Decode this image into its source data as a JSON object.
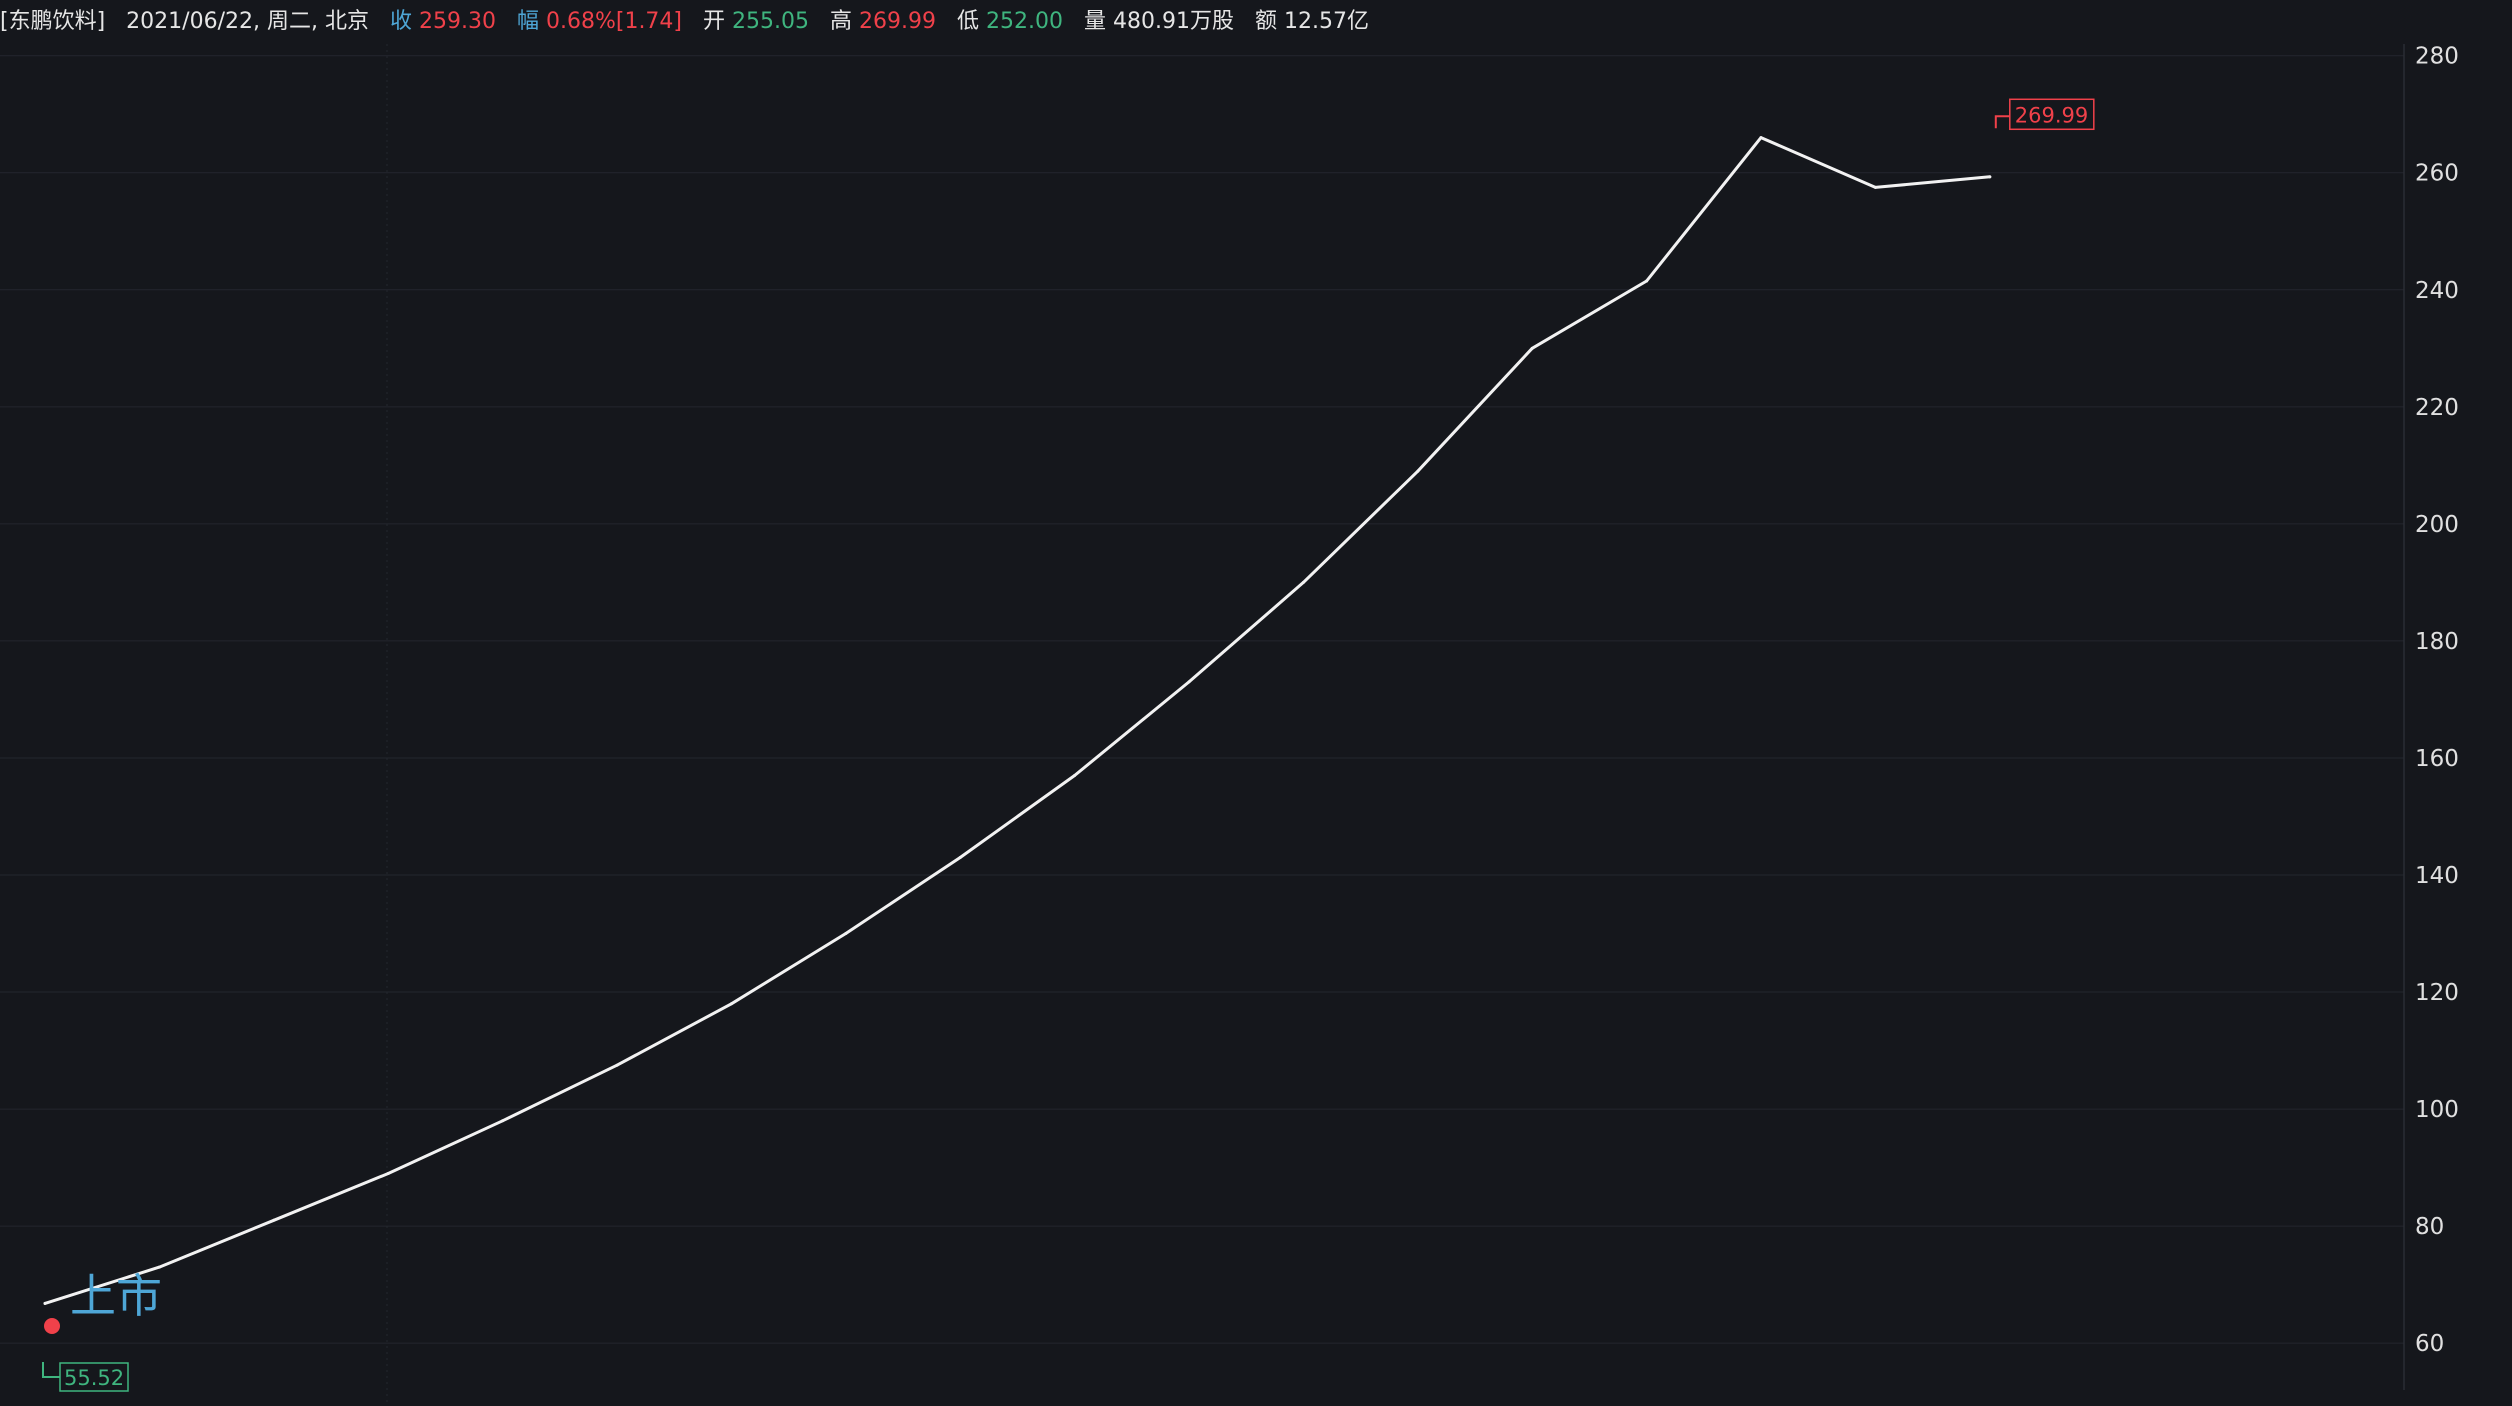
{
  "info": {
    "name": "[东鹏饮料]",
    "date": "2021/06/22, 周二, 北京",
    "close_label": "收",
    "close_value": "259.30",
    "change_label": "幅",
    "change_value": "0.68%",
    "change_bracket": "[1.74]",
    "open_label": "开",
    "open_value": "255.05",
    "high_label": "高",
    "high_value": "269.99",
    "low_label": "低",
    "low_value": "252.00",
    "volume_label": "量",
    "volume_value": "480.91万股",
    "amount_label": "额",
    "amount_value": "12.57亿"
  },
  "colors": {
    "background": "#15171c",
    "line": "#f2f2f2",
    "grid": "#24272e",
    "up": "#f0414a",
    "down": "#3fb57f",
    "accent": "#4ea6d6"
  },
  "chart_data": {
    "type": "line",
    "x": [
      0,
      1,
      2,
      3,
      4,
      5,
      6,
      7,
      8,
      9,
      10,
      11,
      12,
      13,
      14,
      15,
      16,
      17
    ],
    "values": [
      66.8,
      73.0,
      81.0,
      89.0,
      98.0,
      107.5,
      118.0,
      130.0,
      143.0,
      157.0,
      173.0,
      190.0,
      209.0,
      230.0,
      241.5,
      266.0,
      257.5,
      259.3
    ],
    "ylim": [
      52,
      282
    ],
    "yticks": [
      60,
      80,
      100,
      120,
      140,
      160,
      180,
      200,
      220,
      240,
      260,
      280
    ],
    "grid": true,
    "max_label": "269.99",
    "min_label": "55.52",
    "event_label": "上市"
  }
}
